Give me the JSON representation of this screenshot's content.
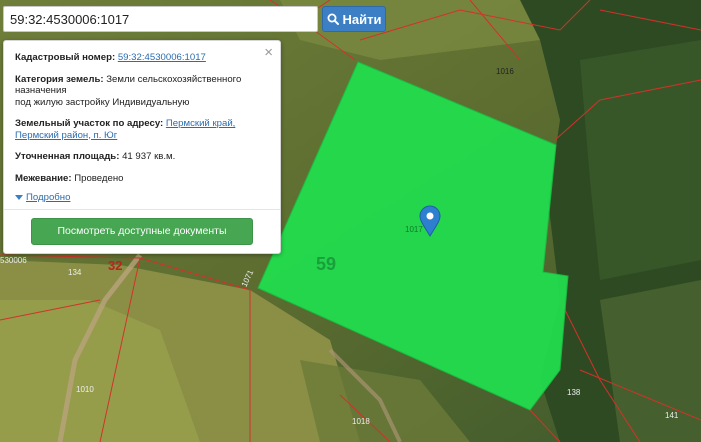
{
  "search": {
    "value": "59:32:4530006:1017",
    "button_label": "Найти"
  },
  "info_panel": {
    "cadastral_label": "Кадастровый номер:",
    "cadastral_value": "59:32:4530006:1017",
    "category_label": "Категория земель:",
    "category_value_line1": "Земли сельскохозяйственного",
    "category_value_line2": "назначения",
    "category_value_line3": "под жилую застройку Индивидуальную",
    "address_label": "Земельный участок по адресу:",
    "address_value_line1": "Пермский край,",
    "address_value_line2": "Пермский район, п. Юг",
    "area_label": "Уточненная площадь:",
    "area_value": "41 937 кв.м.",
    "survey_label": "Межевание:",
    "survey_value": "Проведено",
    "more_label": "Подробно",
    "docs_button_label": "Посмотреть доступные документы"
  },
  "map_labels": {
    "l1016": "1016",
    "l59": "59",
    "l1017": "1017",
    "l32": "32",
    "l134": "134",
    "l30006": "530006",
    "l1071": "1071",
    "l1010": "1010",
    "l1018": "1018",
    "l138": "138",
    "l141": "141"
  },
  "colors": {
    "parcel": "#20e04e",
    "boundary": "#d2322a",
    "button_blue": "#3c7fc4",
    "button_green": "#46a651",
    "marker": "#2f7fd0"
  }
}
